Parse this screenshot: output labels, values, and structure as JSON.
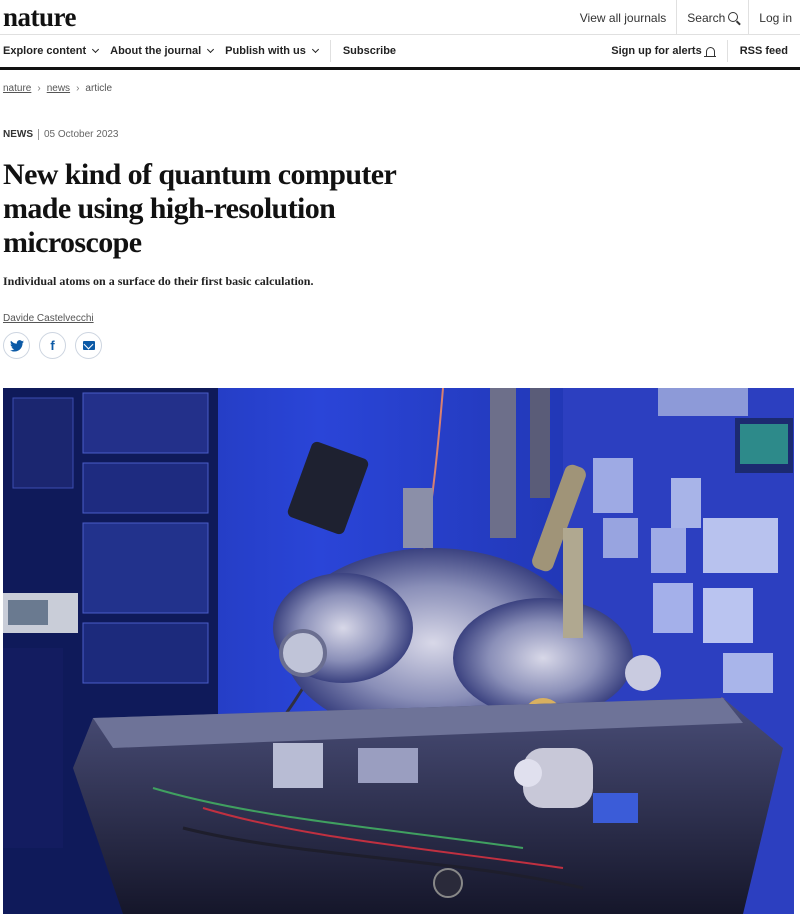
{
  "header": {
    "logo": "nature",
    "view_all_journals": "View all journals",
    "search": "Search",
    "login": "Log in"
  },
  "nav": {
    "explore": "Explore content",
    "about": "About the journal",
    "publish": "Publish with us",
    "subscribe": "Subscribe",
    "alerts": "Sign up for alerts",
    "rss": "RSS feed"
  },
  "breadcrumb": {
    "items": [
      "nature",
      "news",
      "article"
    ],
    "separator": "›"
  },
  "article": {
    "type": "NEWS",
    "date": "05 October 2023",
    "title": "New kind of quantum computer made using high-resolution microscope",
    "standfirst": "Individual atoms on a surface do their first basic calculation.",
    "author": "Davide Castelvecchi"
  },
  "share": {
    "twitter_icon": "twitter-icon",
    "facebook_glyph": "f",
    "email_icon": "email-icon"
  },
  "colors": {
    "share_blue": "#0c5aa6",
    "photo_blue": "#1e3ad8"
  }
}
